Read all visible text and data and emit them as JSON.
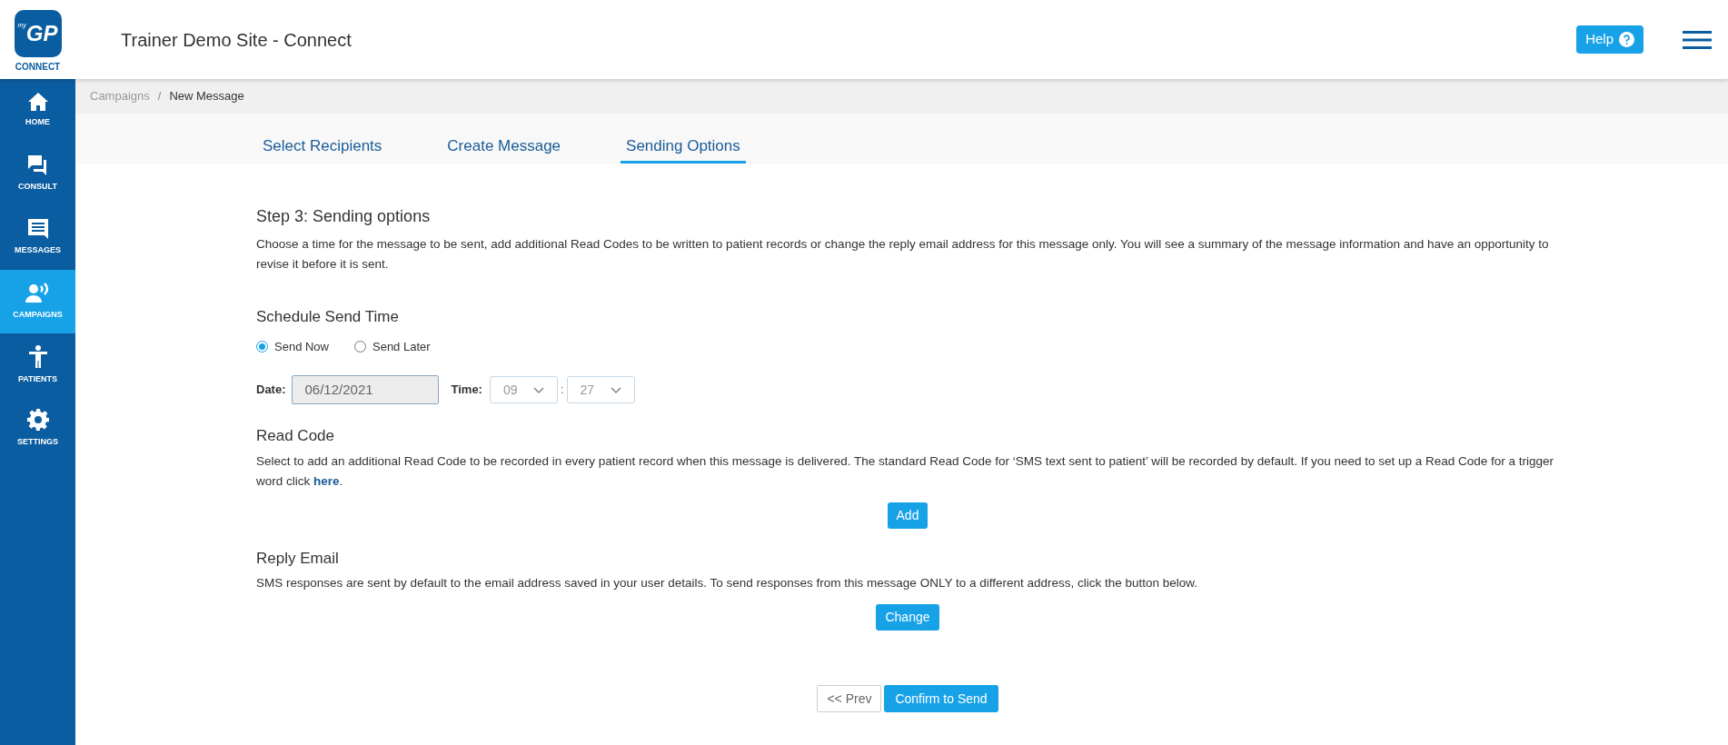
{
  "logo": {
    "small": "my",
    "main": "GP",
    "caption": "CONNECT"
  },
  "header": {
    "title": "Trainer Demo Site - Connect",
    "help_button": "Help"
  },
  "sidebar": {
    "items": [
      {
        "kind": "home",
        "label": "HOME",
        "selected": false
      },
      {
        "kind": "consult",
        "label": "CONSULT",
        "selected": false
      },
      {
        "kind": "messages",
        "label": "MESSAGES",
        "selected": false
      },
      {
        "kind": "campaigns",
        "label": "CAMPAIGNS",
        "selected": true
      },
      {
        "kind": "patients",
        "label": "PATIENTS",
        "selected": false
      },
      {
        "kind": "settings",
        "label": "SETTINGS",
        "selected": false
      }
    ]
  },
  "breadcrumb_separator": "/",
  "breadcrumb": [
    {
      "label": "Campaigns",
      "current": false
    },
    {
      "label": "New Message",
      "current": true
    }
  ],
  "tabs": [
    {
      "label": "Select Recipients",
      "selected": false
    },
    {
      "label": "Create Message",
      "selected": false
    },
    {
      "label": "Sending Options",
      "selected": true
    }
  ],
  "step": {
    "title": "Step 3: Sending options",
    "description": "Choose a time for the message to be sent, add additional Read Codes to be written to patient records or change the reply email address for this message only. You will see a summary of the message information and have an opportunity to revise it before it is sent."
  },
  "schedule": {
    "title": "Schedule Send Time",
    "options": [
      {
        "label": "Send Now",
        "selected": true
      },
      {
        "label": "Send Later",
        "selected": false
      }
    ],
    "date_label": "Date:",
    "date_value": "06/12/2021",
    "time_label": "Time:",
    "hour": "09",
    "separator": ":",
    "minute": "27",
    "disabled": true
  },
  "read_code": {
    "title": "Read Code",
    "description_before": "Select to add an additional Read Code to be recorded in every patient record when this message is delivered. The standard Read Code for ‘SMS text sent to patient’ will be recorded by default. If you need to set up a Read Code for a trigger word click ",
    "link": "here",
    "description_after": ".",
    "button": "Add"
  },
  "reply_email": {
    "title": "Reply Email",
    "description": "SMS responses are sent by default to the email address saved in your user details. To send responses from this message ONLY to a different address, click the button below.",
    "button": "Change"
  },
  "footer": {
    "prev_button": "<< Prev",
    "confirm_button": "Confirm to Send"
  }
}
